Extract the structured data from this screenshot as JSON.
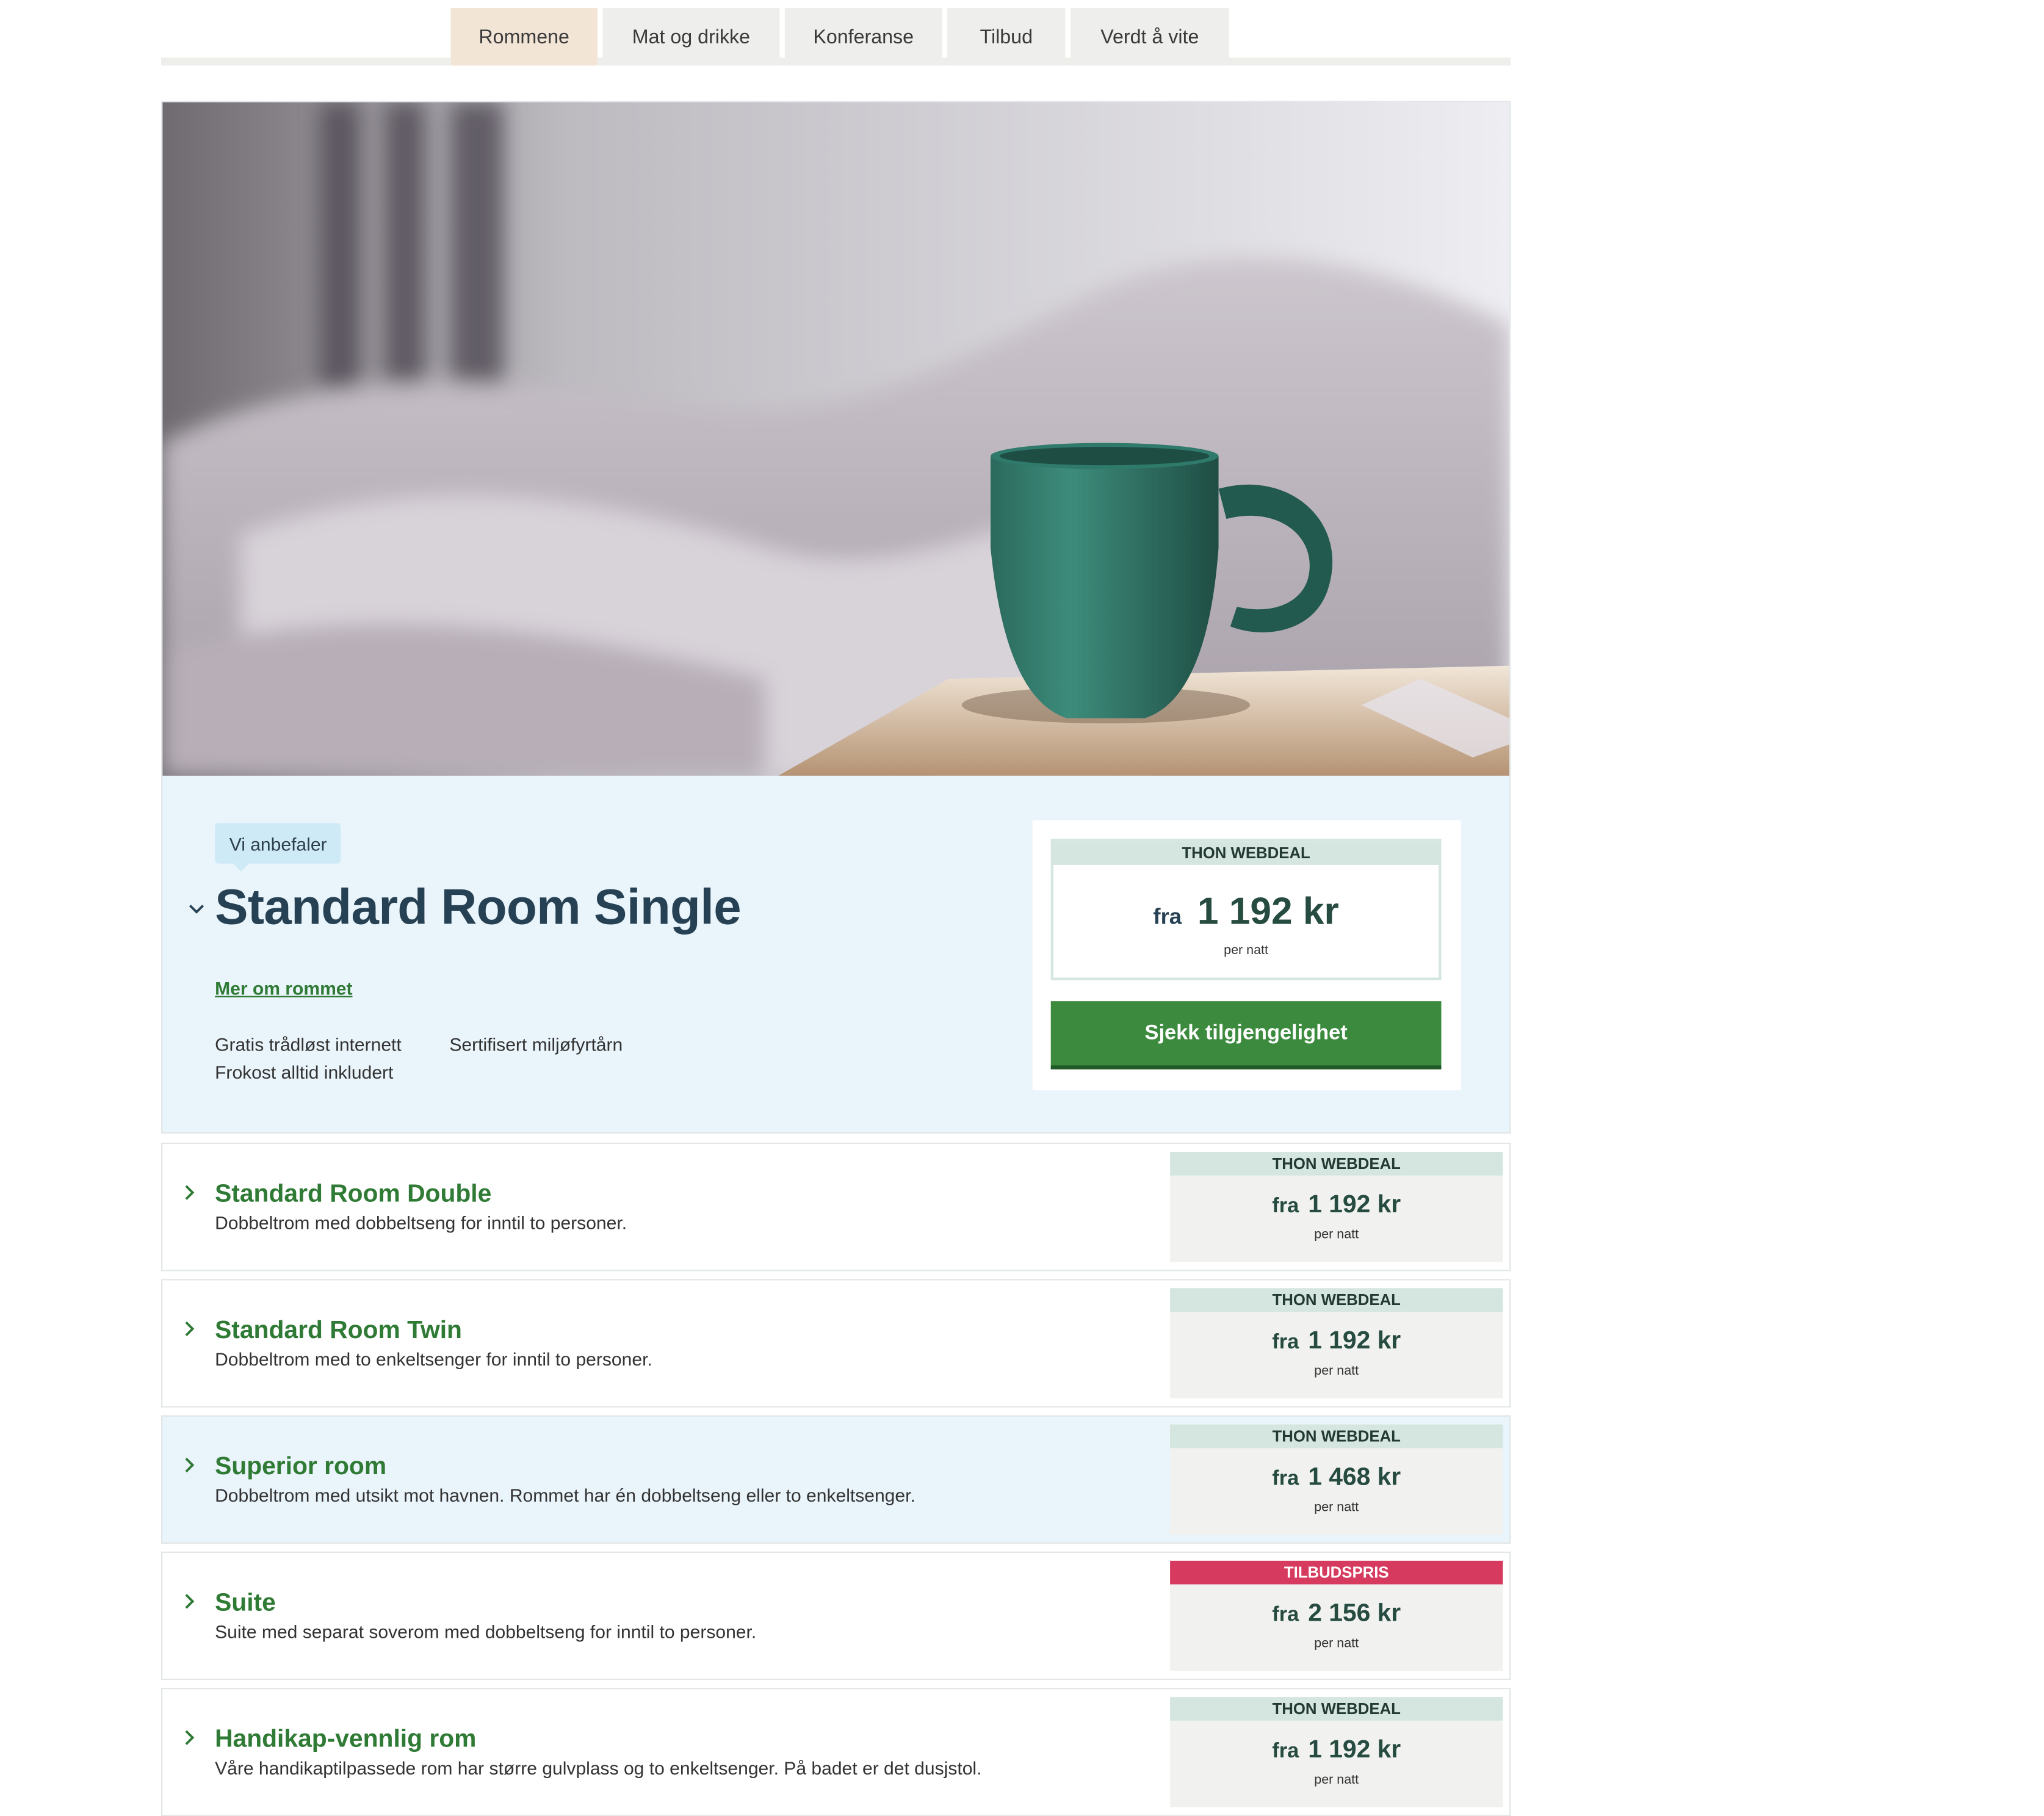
{
  "nav": {
    "tabs": [
      {
        "label": "Rommene",
        "active": true
      },
      {
        "label": "Mat og drikke"
      },
      {
        "label": "Konferanse"
      },
      {
        "label": "Tilbud"
      },
      {
        "label": "Verdt å vite"
      }
    ]
  },
  "featured": {
    "badge": "Vi anbefaler",
    "title": "Standard Room Single",
    "more_link": "Mer om rommet",
    "features": [
      "Gratis trådløst internett",
      "Sertifisert miljøfyrtårn",
      "Frokost alltid inkludert"
    ],
    "deal_label": "THON WEBDEAL",
    "price_prefix": "fra",
    "price": "1 192 kr",
    "per": "per natt",
    "cta": "Sjekk tilgjengelighet"
  },
  "rooms": [
    {
      "title": "Standard Room Double",
      "desc": "Dobbeltrom med dobbeltseng for inntil to personer.",
      "label": "THON WEBDEAL",
      "prefix": "fra",
      "price": "1 192 kr",
      "per": "per natt"
    },
    {
      "title": "Standard Room Twin",
      "desc": "Dobbeltrom med to enkeltsenger for inntil to personer.",
      "label": "THON WEBDEAL",
      "prefix": "fra",
      "price": "1 192 kr",
      "per": "per natt"
    },
    {
      "title": "Superior room",
      "desc": "Dobbeltrom med utsikt mot havnen. Rommet har én dobbeltseng eller to enkeltsenger.",
      "label": "THON WEBDEAL",
      "prefix": "fra",
      "price": "1 468 kr",
      "per": "per natt"
    },
    {
      "title": "Suite",
      "desc": "Suite med separat soverom med dobbeltseng for inntil to personer.",
      "label": "TILBUDSPRIS",
      "prefix": "fra",
      "price": "2 156 kr",
      "per": "per natt"
    },
    {
      "title": "Handikap-vennlig rom",
      "desc": "Våre handikaptilpassede rom har større gulvplass og to enkeltsenger. På badet er det dusjstol.",
      "label": "THON WEBDEAL",
      "prefix": "fra",
      "price": "1 192 kr",
      "per": "per natt"
    }
  ],
  "colors": {
    "brand_green": "#3b8a3e",
    "title_blue": "#264153",
    "deal_label_bg": "#d5e6e0",
    "sale_label_bg": "#d63a5f",
    "active_tab": "#f3e5d6",
    "highlight_bg": "#e9f4fb"
  }
}
